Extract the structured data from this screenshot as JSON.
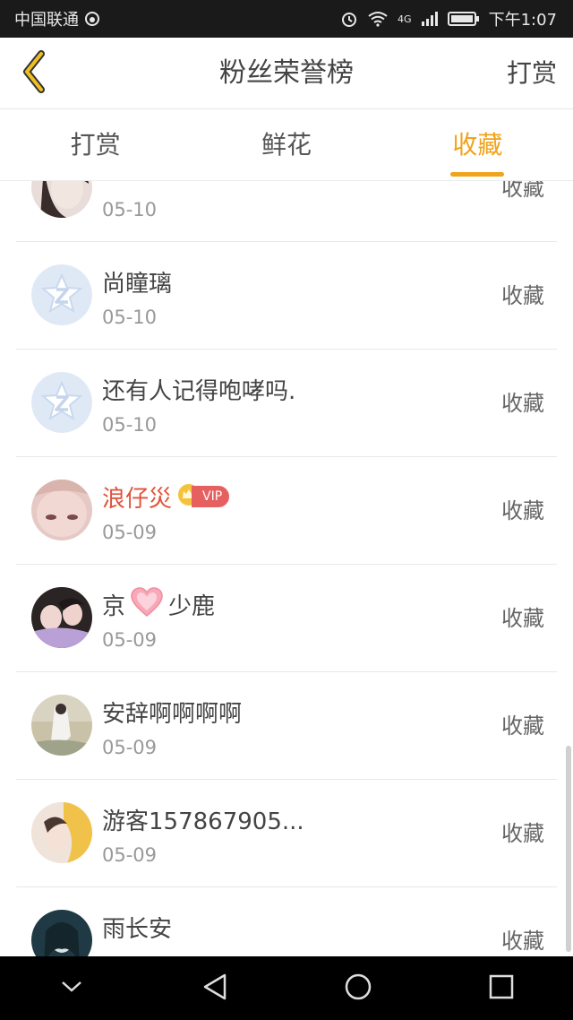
{
  "status_bar": {
    "carrier": "中国联通",
    "network": "4G",
    "time": "下午1:07"
  },
  "header": {
    "title": "粉丝荣誉榜",
    "action_label": "打赏"
  },
  "tabs": [
    {
      "label": "打赏",
      "active": false
    },
    {
      "label": "鲜花",
      "active": false
    },
    {
      "label": "收藏",
      "active": true
    }
  ],
  "list": {
    "items": [
      {
        "name": "",
        "date": "05-10",
        "action": "收藏"
      },
      {
        "name": "尚瞳璃",
        "date": "05-10",
        "action": "收藏"
      },
      {
        "name": "还有人记得咆哮吗.",
        "date": "05-10",
        "action": "收藏"
      },
      {
        "name": "浪仔災",
        "date": "05-09",
        "action": "收藏",
        "vip_label": "VIP"
      },
      {
        "name_prefix": "京",
        "name_suffix": "少鹿",
        "date": "05-09",
        "action": "收藏"
      },
      {
        "name": "安辞啊啊啊啊",
        "date": "05-09",
        "action": "收藏"
      },
      {
        "name": "游客157867905...",
        "date": "05-09",
        "action": "收藏"
      },
      {
        "name": "雨长安",
        "date": "",
        "action": "收藏"
      }
    ]
  },
  "colors": {
    "accent": "#f0a31c",
    "highlight_name": "#e0533a",
    "vip_badge": "#e66060"
  }
}
